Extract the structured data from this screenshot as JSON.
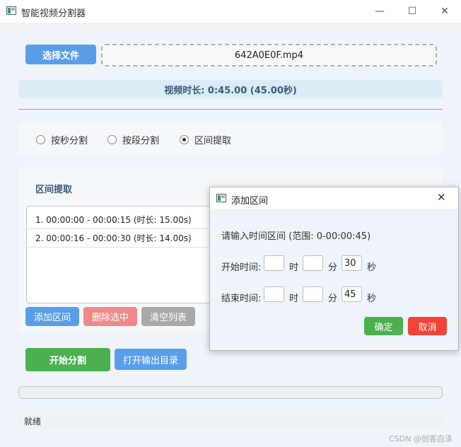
{
  "window": {
    "title": "智能视频分割器",
    "minimize_glyph": "—",
    "maximize_glyph": "☐",
    "close_glyph": "✕"
  },
  "file": {
    "select_label": "选择文件",
    "filename": "642A0E0F.mp4"
  },
  "duration_text": "视频时长: 0:45.00 (45.00秒)",
  "modes": [
    {
      "label": "按秒分割",
      "selected": false
    },
    {
      "label": "按段分割",
      "selected": false
    },
    {
      "label": "区间提取",
      "selected": true
    }
  ],
  "interval_panel": {
    "title": "区间提取",
    "items": [
      "1. 00:00:00 - 00:00:15 (时长: 15.00s)",
      "2. 00:00:16 - 00:00:30 (时长: 14.00s)"
    ],
    "add_label": "添加区间",
    "delete_label": "删除选中",
    "clear_label": "清空列表"
  },
  "actions": {
    "start_label": "开始分割",
    "open_output_label": "打开输出目录"
  },
  "progress": 0,
  "status_text": "就绪",
  "watermark": "CSDN @创客白泽",
  "dialog": {
    "title": "添加区间",
    "prompt": "请输入时间区间 (范围: 0-00:00:45)",
    "start_label": "开始时间:",
    "end_label": "结束时间:",
    "hour_unit": "时",
    "minute_unit": "分",
    "second_unit": "秒",
    "start": {
      "h": "",
      "m": "",
      "s": "30"
    },
    "end": {
      "h": "",
      "m": "",
      "s": "45"
    },
    "ok_label": "确定",
    "cancel_label": "取消"
  },
  "colors": {
    "blue": "#5b9ee8",
    "red": "#f08a8a",
    "gray": "#a9a9a9",
    "green": "#4caf50",
    "cancel_red": "#f44336"
  }
}
